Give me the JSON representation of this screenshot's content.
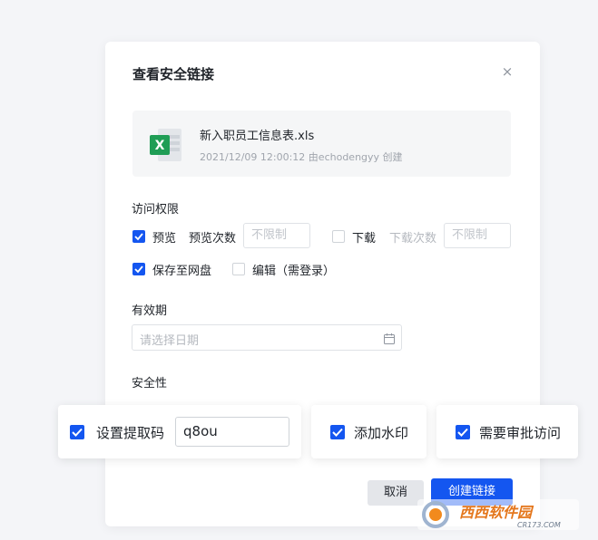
{
  "dialog": {
    "title": "查看安全链接",
    "close_glyph": "×"
  },
  "file": {
    "icon": "excel-file-icon",
    "icon_letter": "X",
    "name": "新入职员工信息表.xls",
    "meta": "2021/12/09  12:00:12  由echodengyy 创建"
  },
  "access": {
    "label": "访问权限",
    "preview": {
      "label": "预览",
      "checked": true
    },
    "preview_count": {
      "label": "预览次数",
      "placeholder": "不限制"
    },
    "download": {
      "label": "下载",
      "checked": false
    },
    "download_count": {
      "label": "下载次数",
      "placeholder": "不限制"
    },
    "save_to_drive": {
      "label": "保存至网盘",
      "checked": true
    },
    "edit": {
      "label": "编辑（需登录）",
      "checked": false
    }
  },
  "validity": {
    "label": "有效期",
    "placeholder": "请选择日期"
  },
  "security": {
    "label": "安全性",
    "extract_code": {
      "label": "设置提取码",
      "checked": true,
      "value": "q8ou"
    },
    "watermark": {
      "label": "添加水印",
      "checked": true
    },
    "approval": {
      "label": "需要审批访问",
      "checked": true
    }
  },
  "actions": {
    "cancel": "取消",
    "create": "创建链接"
  },
  "overlay": {
    "logo_text": "西西软件园",
    "logo_url_text": "CR173.COM"
  },
  "colors": {
    "accent": "#1456f0",
    "excel_green": "#1f9d55"
  }
}
